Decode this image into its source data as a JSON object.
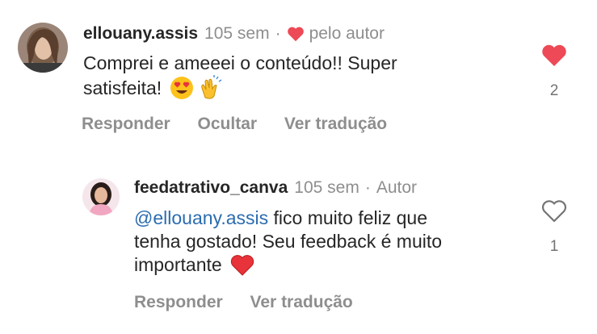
{
  "comments": [
    {
      "username": "ellouany.assis",
      "time": "105 sem",
      "separator": "·",
      "author_note": "pelo autor",
      "text_line1": "Comprei e ameeei o conteúdo!! Super",
      "text_line2": "satisfeita!",
      "emojis": [
        "heart-eyes-emoji",
        "clapping-hands-emoji"
      ],
      "likes": "2",
      "liked": true,
      "actions": [
        "Responder",
        "Ocultar",
        "Ver tradução"
      ]
    },
    {
      "username": "feedatrativo_canva",
      "time": "105 sem",
      "separator": "·",
      "author_badge": "Autor",
      "mention": "@ellouany.assis",
      "text_line1": " fico muito feliz que",
      "text_line2": "tenha gostado! Seu feedback é muito",
      "text_line3": "importante",
      "emojis": [
        "red-heart-emoji"
      ],
      "likes": "1",
      "liked": false,
      "actions": [
        "Responder",
        "Ver tradução"
      ]
    }
  ],
  "colors": {
    "like_red": "#ed4956",
    "mention_blue": "#2b6cb0",
    "meta_gray": "#8e8e8e"
  }
}
